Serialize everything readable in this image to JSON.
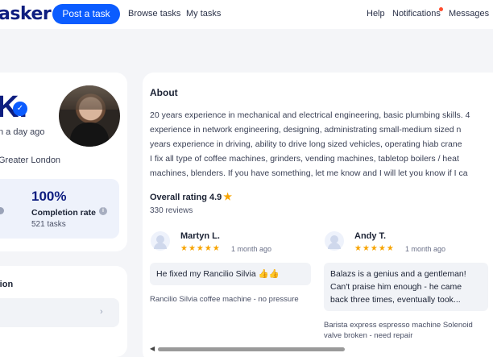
{
  "header": {
    "logo": "asker",
    "post_task": "Post a task",
    "browse": "Browse tasks",
    "my_tasks": "My tasks",
    "help": "Help",
    "notifications": "Notifications",
    "messages": "Messages"
  },
  "profile": {
    "initial": "K.",
    "last_online": "n a day ago",
    "location": "Greater London",
    "completion_value": "100%",
    "completion_label": "Completion rate",
    "completion_sub": "521 tasks",
    "verification_title": "tion"
  },
  "about": {
    "title": "About",
    "lines": [
      "20 years experience in mechanical and electrical engineering, basic plumbing skills. 4",
      "experience in network engineering, designing, administrating small-medium sized n",
      "years experience in driving, ability to drive long sized vehicles, operating hiab crane",
      "I fix all type of coffee machines, grinders, vending machines, tabletop boilers  / heat",
      "machines, blenders. If you have something, let me know and I will let you know if I ca"
    ]
  },
  "rating": {
    "title": "Overall rating 4.9",
    "count": "330 reviews"
  },
  "reviews": [
    {
      "name": "Martyn L.",
      "stars": "★★★★★",
      "time": "1 month ago",
      "text_lines": [
        "He fixed my Rancilio Silvia 👍👍"
      ],
      "task_lines": [
        "Rancilio Silvia coffee machine - no pressure"
      ]
    },
    {
      "name": "Andy T.",
      "stars": "★★★★★",
      "time": "1 month ago",
      "text_lines": [
        "Balazs is a genius and a gentleman!",
        "Can't praise him enough - he came",
        "back three times, eventually took..."
      ],
      "task_lines": [
        "Barista express espresso machine Solenoid",
        "valve broken - need repair"
      ]
    }
  ],
  "icons": {
    "verified": "verified-badge-icon",
    "info": "info-icon",
    "star": "star-icon",
    "chevron": "chevron-right-icon"
  },
  "colors": {
    "primary": "#0b5cff",
    "brand": "#0e1e80",
    "star": "#f7a400",
    "notification_dot": "#ff4d2e"
  }
}
